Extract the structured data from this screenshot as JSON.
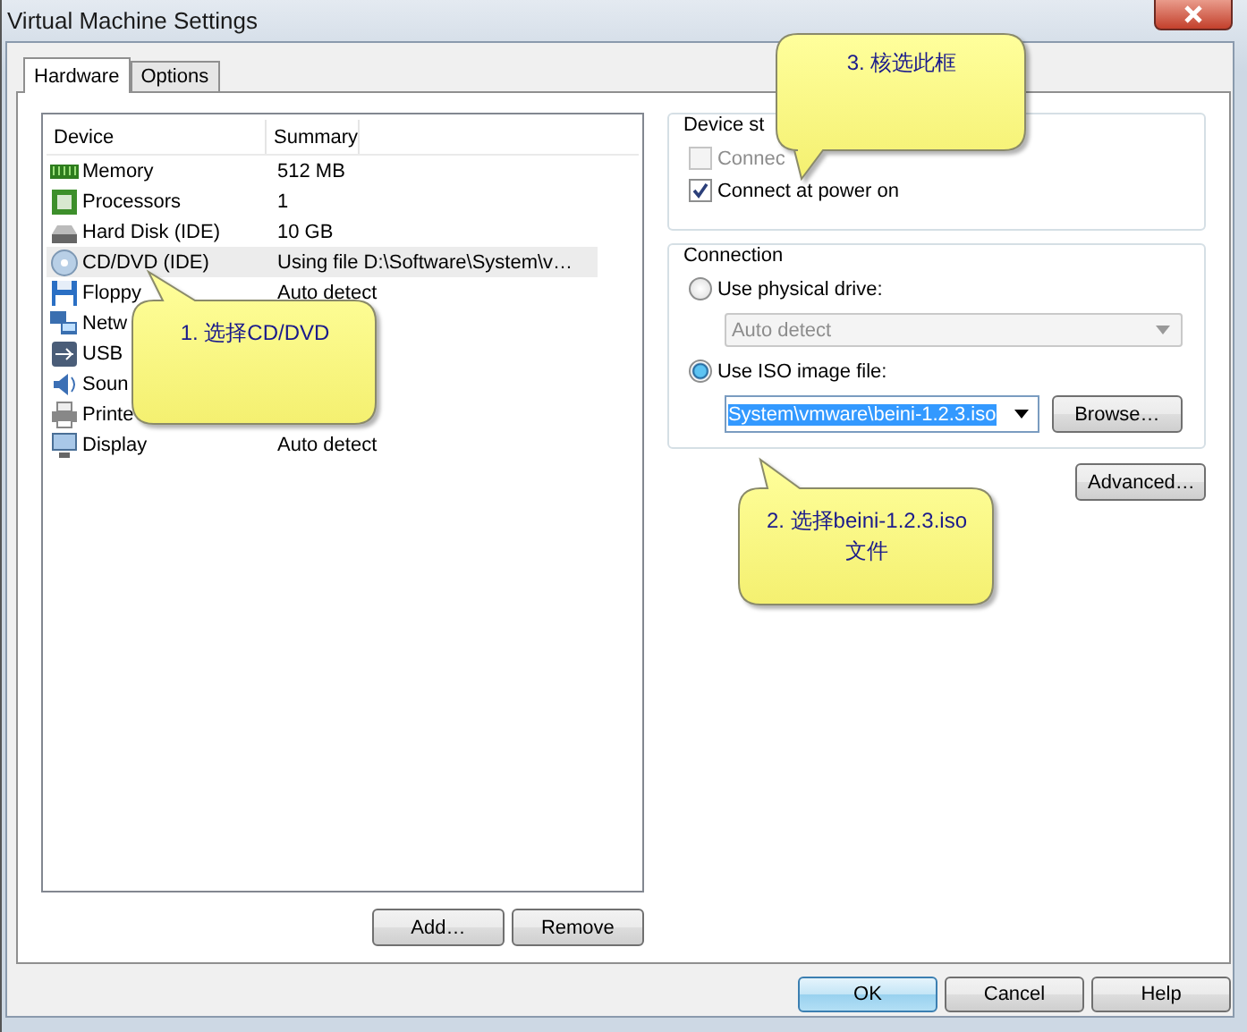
{
  "window": {
    "title": "Virtual Machine Settings"
  },
  "tabs": [
    {
      "label": "Hardware",
      "selected": true
    },
    {
      "label": "Options",
      "selected": false
    }
  ],
  "device_list": {
    "columns": [
      "Device",
      "Summary"
    ],
    "rows": [
      {
        "kind": "memory",
        "device": "Memory",
        "summary": "512 MB",
        "selected": false
      },
      {
        "kind": "processor",
        "device": "Processors",
        "summary": "1",
        "selected": false
      },
      {
        "kind": "disk",
        "device": "Hard Disk (IDE)",
        "summary": "10 GB",
        "selected": false
      },
      {
        "kind": "cd",
        "device": "CD/DVD (IDE)",
        "summary": "Using file D:\\Software\\System\\v…",
        "selected": true
      },
      {
        "kind": "floppy",
        "device": "Floppy",
        "summary": "Auto detect",
        "selected": false
      },
      {
        "kind": "network",
        "device": "Netw",
        "selected": false
      },
      {
        "kind": "usb",
        "device": "USB",
        "selected": false
      },
      {
        "kind": "sound",
        "device": "Soun",
        "selected": false
      },
      {
        "kind": "printer",
        "device": "Printe",
        "selected": false
      },
      {
        "kind": "display",
        "device": "Display",
        "summary": "Auto detect",
        "selected": false
      }
    ]
  },
  "list_buttons": [
    "Add…",
    "Remove"
  ],
  "device_status": {
    "title": "Device st",
    "options": [
      {
        "label": "Connec",
        "checked": false,
        "disabled": true
      },
      {
        "label": "Connect at power on",
        "checked": true,
        "disabled": false
      }
    ]
  },
  "connection": {
    "title": "Connection",
    "options": [
      {
        "kind": "dropdown",
        "label": "Use physical drive:",
        "selected": false,
        "value": "Auto detect",
        "disabled": true
      },
      {
        "kind": "combo",
        "label": "Use ISO image file:",
        "selected": true,
        "value": "System\\vmware\\beini-1.2.3.iso",
        "disabled": false,
        "button": "Browse…"
      }
    ]
  },
  "advanced_button": "Advanced…",
  "dialog_buttons": [
    {
      "label": "OK",
      "default": true
    },
    {
      "label": "Cancel",
      "default": false
    },
    {
      "label": "Help",
      "default": false
    }
  ],
  "callouts": [
    {
      "text": "1. 选择CD/DVD"
    },
    {
      "text": "3. 核选此框"
    },
    {
      "text": "2. 选择beini-1.2.3.iso文件"
    }
  ]
}
